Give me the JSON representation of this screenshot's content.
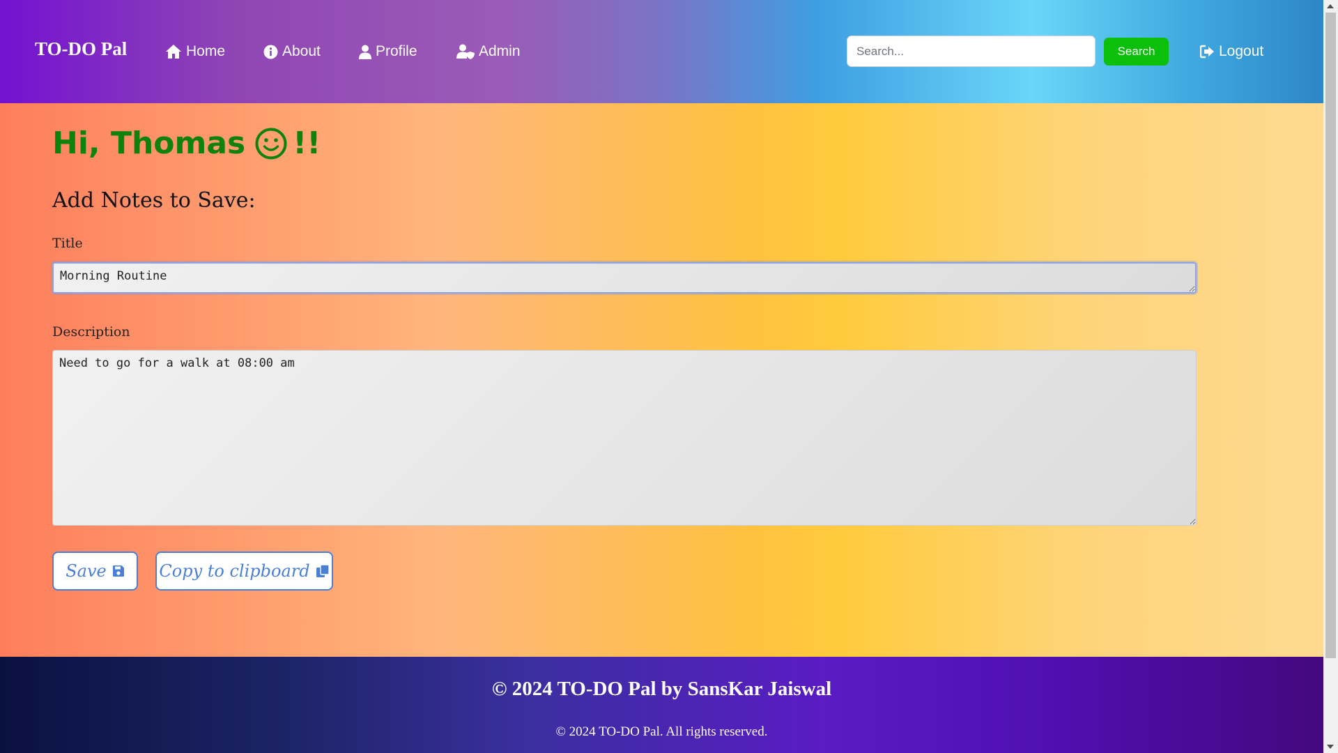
{
  "navbar": {
    "brand": "TO-DO Pal",
    "links": [
      {
        "label": "Home",
        "icon": "home-icon"
      },
      {
        "label": "About",
        "icon": "info-icon"
      },
      {
        "label": "Profile",
        "icon": "user-icon"
      },
      {
        "label": "Admin",
        "icon": "user-shield-icon"
      }
    ],
    "search_placeholder": "Search...",
    "search_label": "Search",
    "logout_label": "Logout",
    "logout_icon": "logout-icon"
  },
  "main": {
    "greeting_prefix": "Hi, Thomas",
    "greeting_suffix": "!!",
    "greeting_icon": "smiley-icon",
    "section_heading": "Add Notes to Save:",
    "title_label": "Title",
    "title_value": "Morning Routine",
    "description_label": "Description",
    "description_value": "Need to go for a walk at 08:00 am",
    "save_label": "Save",
    "save_icon": "floppy-disk-icon",
    "copy_label": "Copy to clipboard",
    "copy_icon": "copy-icon"
  },
  "footer": {
    "title": "© 2024 TO-DO Pal by SansKar Jaiswal",
    "note": "© 2024 TO-DO Pal. All rights reserved."
  },
  "colors": {
    "greeting": "#0d820d",
    "search_button": "#0bbf0b",
    "outline_button": "#4a7fd6"
  }
}
